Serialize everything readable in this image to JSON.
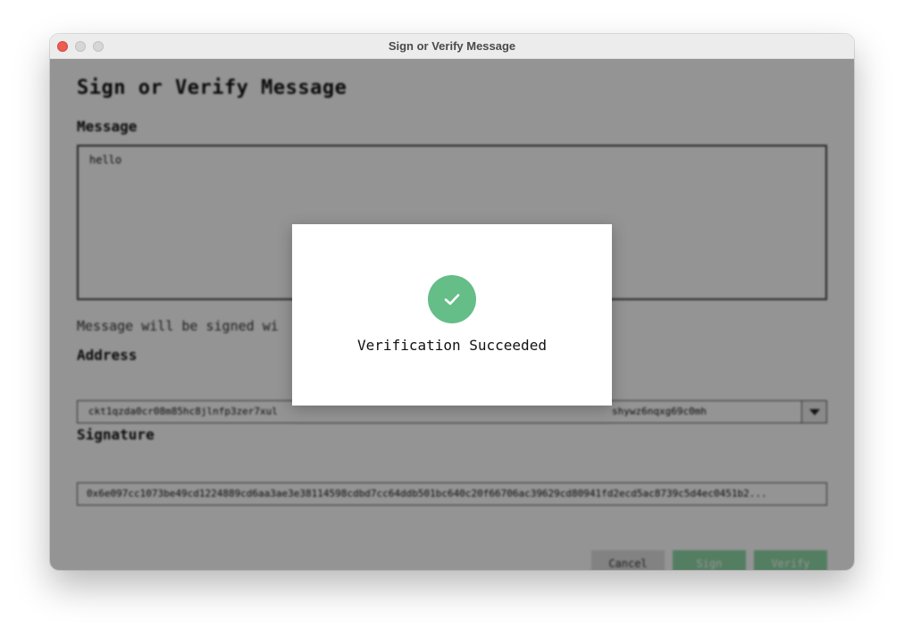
{
  "window": {
    "title": "Sign or Verify Message"
  },
  "page": {
    "heading": "Sign or Verify Message",
    "message_label": "Message",
    "message_value": "hello",
    "hint": "Message will be signed wi",
    "address_label": "Address",
    "address_value": "ckt1qzda0cr08m85hc8jlnfp3zer7xul",
    "address_tail": "shywz6nqxg69c0mh",
    "signature_label": "Signature",
    "signature_value": "0x6e097cc1073be49cd1224889cd6aa3ae3e38114598cdbd7cc64ddb501bc640c20f66706ac39629cd80941fd2ecd5ac8739c5d4ec0451b2..."
  },
  "buttons": {
    "cancel": "Cancel",
    "sign": "Sign",
    "verify": "Verify"
  },
  "dialog": {
    "icon": "check-circle-icon",
    "message": "Verification Succeeded"
  },
  "colors": {
    "success": "#65bd87",
    "primary_button": "#8fd9a8"
  }
}
